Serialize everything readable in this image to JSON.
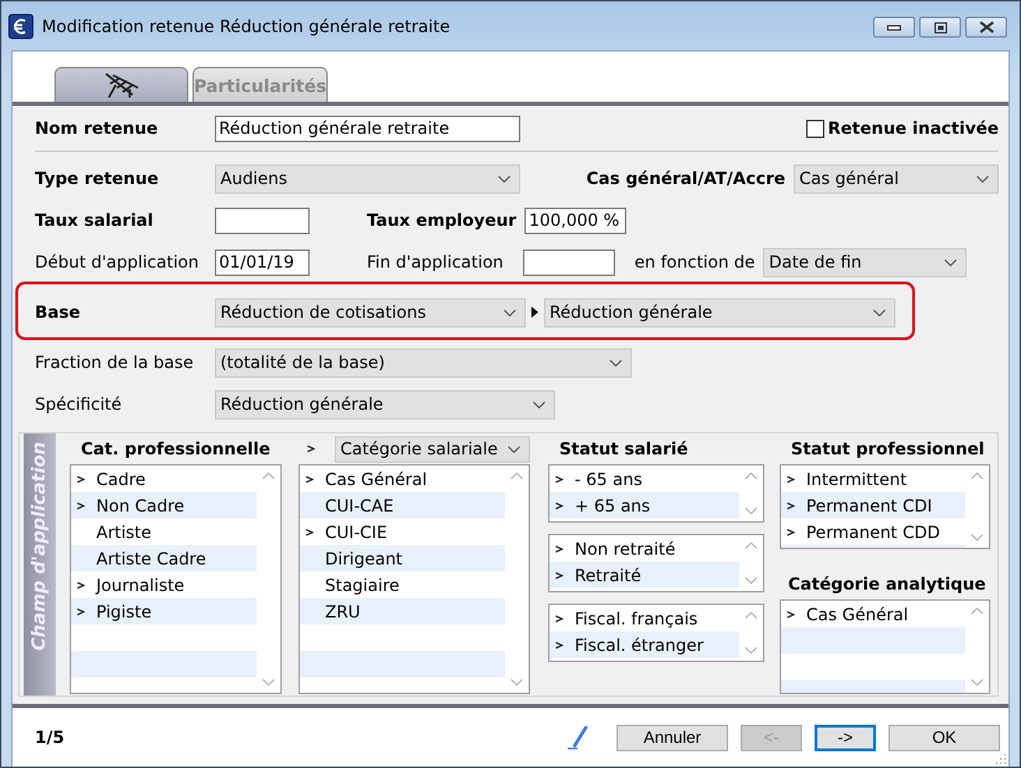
{
  "window": {
    "title": "Modification retenue Réduction générale retraite"
  },
  "tabs": [
    {
      "kind": "icon",
      "selected": true
    },
    {
      "kind": "text",
      "label": "Particularités",
      "selected": false
    }
  ],
  "form": {
    "nom_retenue": {
      "label": "Nom retenue",
      "value": "Réduction générale retraite"
    },
    "retenue_inactivee": {
      "label": "Retenue inactivée",
      "checked": false
    },
    "type_retenue": {
      "label": "Type retenue",
      "value": "Audiens"
    },
    "cas_general": {
      "label": "Cas général/AT/Accre",
      "value": "Cas général"
    },
    "taux_salarial": {
      "label": "Taux salarial"
    },
    "taux_employeur": {
      "label": "Taux employeur",
      "value": "100,000 %"
    },
    "debut_application": {
      "label": "Début d'application",
      "value": "01/01/19"
    },
    "fin_application": {
      "label": "Fin d'application"
    },
    "en_fonction_de": {
      "label": "en fonction de",
      "value": "Date de fin"
    },
    "base": {
      "label": "Base",
      "highlighted": true,
      "value": "Réduction de cotisations",
      "sub_value": "Réduction générale"
    },
    "fraction": {
      "label": "Fraction de la base",
      "value": "(totalité de la base)"
    },
    "specificite": {
      "label": "Spécificité",
      "value": "Réduction générale"
    }
  },
  "scope": {
    "title": "Champ d'application",
    "columns": [
      {
        "sections": [
          {
            "header": {
              "kind": "text",
              "label": "Cat. professionnelle"
            },
            "lists": [
              {
                "items": [
                  {
                    "label": "Cadre",
                    "marked": true
                  },
                  {
                    "label": "Non Cadre",
                    "marked": true
                  },
                  {
                    "label": "Artiste",
                    "marked": false
                  },
                  {
                    "label": "Artiste Cadre",
                    "marked": false
                  },
                  {
                    "label": "Journaliste",
                    "marked": true
                  },
                  {
                    "label": "Pigiste",
                    "marked": true
                  }
                ]
              }
            ]
          }
        ]
      },
      {
        "sections": [
          {
            "header": {
              "kind": "select",
              "value": "Catégorie salariale",
              "marked": true
            },
            "lists": [
              {
                "items": [
                  {
                    "label": "Cas Général",
                    "marked": true
                  },
                  {
                    "label": "CUI-CAE",
                    "marked": false
                  },
                  {
                    "label": "CUI-CIE",
                    "marked": true
                  },
                  {
                    "label": "Dirigeant",
                    "marked": false
                  },
                  {
                    "label": "Stagiaire",
                    "marked": false
                  },
                  {
                    "label": "ZRU",
                    "marked": false
                  }
                ]
              }
            ]
          }
        ]
      },
      {
        "sections": [
          {
            "header": {
              "kind": "text",
              "label": "Statut salarié"
            },
            "lists": [
              {
                "items": [
                  {
                    "label": "- 65 ans",
                    "marked": true
                  },
                  {
                    "label": "+ 65 ans",
                    "marked": true
                  }
                ]
              },
              {
                "items": [
                  {
                    "label": "Non retraité",
                    "marked": true
                  },
                  {
                    "label": "Retraité",
                    "marked": true
                  }
                ]
              },
              {
                "items": [
                  {
                    "label": "Fiscal. français",
                    "marked": true
                  },
                  {
                    "label": "Fiscal. étranger",
                    "marked": true
                  }
                ]
              }
            ]
          }
        ]
      },
      {
        "sections": [
          {
            "header": {
              "kind": "text",
              "label": "Statut professionnel"
            },
            "lists": [
              {
                "items": [
                  {
                    "label": "Intermittent",
                    "marked": true
                  },
                  {
                    "label": "Permanent CDI",
                    "marked": true
                  },
                  {
                    "label": "Permanent CDD",
                    "marked": true
                  }
                ]
              }
            ]
          },
          {
            "header": {
              "kind": "text",
              "label": "Catégorie analytique"
            },
            "lists": [
              {
                "items": [
                  {
                    "label": "Cas Général",
                    "marked": true
                  }
                ]
              }
            ]
          }
        ]
      }
    ]
  },
  "footer": {
    "page": "1/5",
    "buttons": [
      {
        "label": "Annuler",
        "disabled": false,
        "focused": false
      },
      {
        "label": "<-",
        "disabled": true,
        "focused": false
      },
      {
        "label": "->",
        "disabled": false,
        "focused": true
      },
      {
        "label": "OK",
        "disabled": false,
        "focused": false
      }
    ]
  }
}
